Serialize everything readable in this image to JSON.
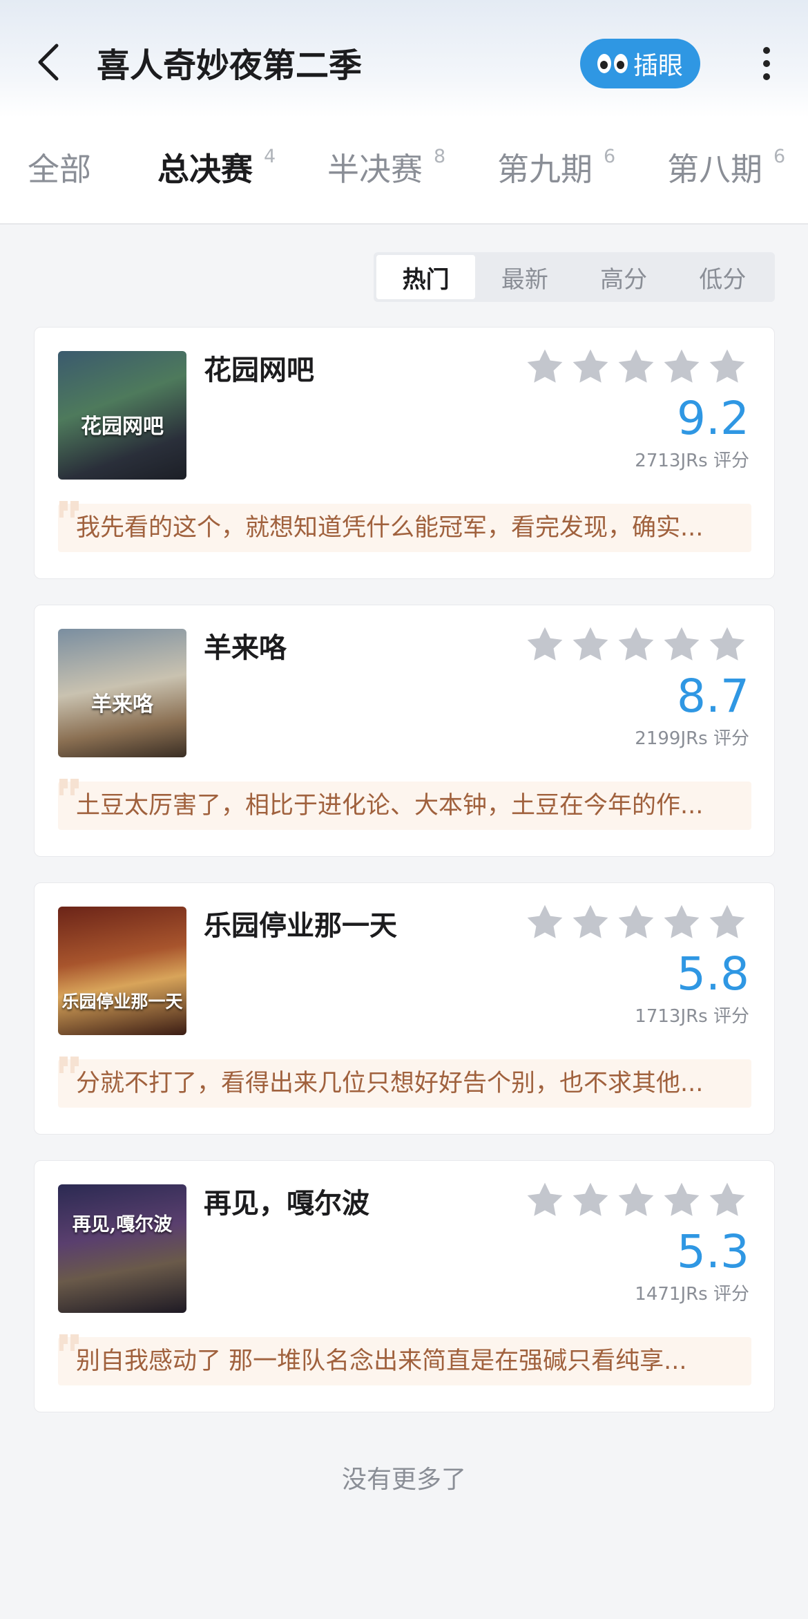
{
  "header": {
    "title": "喜人奇妙夜第二季",
    "peek_label": "插眼",
    "back_icon": "back-arrow-icon",
    "more_icon": "more-vertical-icon"
  },
  "tabs": [
    {
      "label": "全部",
      "count": ""
    },
    {
      "label": "总决赛",
      "count": "4"
    },
    {
      "label": "半决赛",
      "count": "8"
    },
    {
      "label": "第九期",
      "count": "6"
    },
    {
      "label": "第八期",
      "count": "6"
    }
  ],
  "sort": [
    {
      "label": "热门"
    },
    {
      "label": "最新"
    },
    {
      "label": "高分"
    },
    {
      "label": "低分"
    }
  ],
  "items": [
    {
      "title": "花园网吧",
      "thumb_text": "花园网吧",
      "score": "9.2",
      "count": "2713JRs 评分",
      "comment": "我先看的这个，就想知道凭什么能冠军，看完发现，确实..."
    },
    {
      "title": "羊来咯",
      "thumb_text": "羊来咯",
      "score": "8.7",
      "count": "2199JRs 评分",
      "comment": "土豆太厉害了，相比于进化论、大本钟，土豆在今年的作..."
    },
    {
      "title": "乐园停业那一天",
      "thumb_text": "乐园停业那一天",
      "score": "5.8",
      "count": "1713JRs 评分",
      "comment": "分就不打了，看得出来几位只想好好告个别，也不求其他..."
    },
    {
      "title": "再见，嘎尔波",
      "thumb_text": "再见,嘎尔波",
      "score": "5.3",
      "count": "1471JRs 评分",
      "comment": "别自我感动了 那一堆队名念出来简直是在强碱只看纯享..."
    }
  ],
  "footer": "没有更多了",
  "colors": {
    "accent": "#2f97e3",
    "comment_bg": "#fdf5ee",
    "comment_text": "#a0613d",
    "star": "#c3c6cd"
  }
}
